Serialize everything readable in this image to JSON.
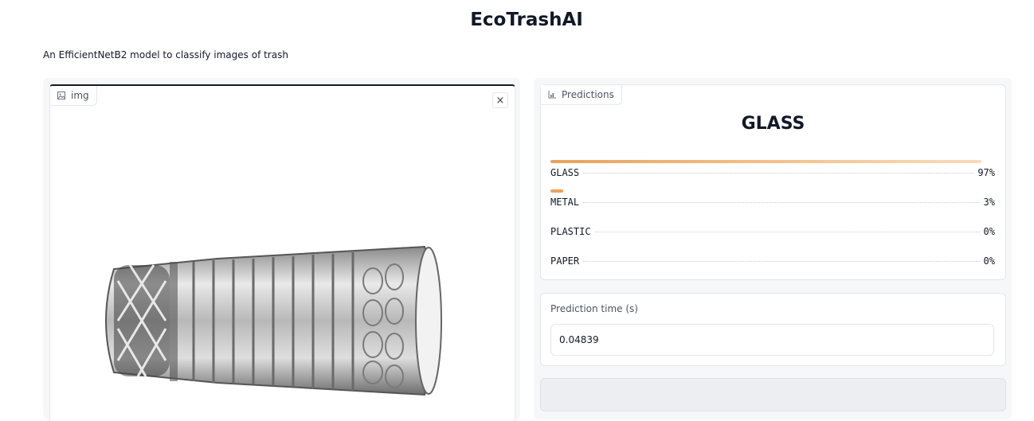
{
  "header": {
    "title": "EcoTrashAI",
    "description": "An EfficientNetB2 model to classify images of trash"
  },
  "image_input": {
    "label": "img",
    "close_symbol": "×"
  },
  "predictions": {
    "label": "Predictions",
    "top_label": "GLASS",
    "confidences": [
      {
        "label": "GLASS",
        "percent_text": "97%",
        "value": 0.97
      },
      {
        "label": "METAL",
        "percent_text": "3%",
        "value": 0.03
      },
      {
        "label": "PLASTIC",
        "percent_text": "0%",
        "value": 0.0
      },
      {
        "label": "PAPER",
        "percent_text": "0%",
        "value": 0.0
      }
    ]
  },
  "prediction_time": {
    "label": "Prediction time (s)",
    "value": "0.04839"
  },
  "colors": {
    "accent": "#e8a35a",
    "border": "#e5e7eb",
    "panel_bg": "#f6f7f9"
  },
  "icons": {
    "image_label_icon": "image-icon",
    "predictions_label_icon": "bar-chart-icon",
    "close": "close-icon"
  }
}
